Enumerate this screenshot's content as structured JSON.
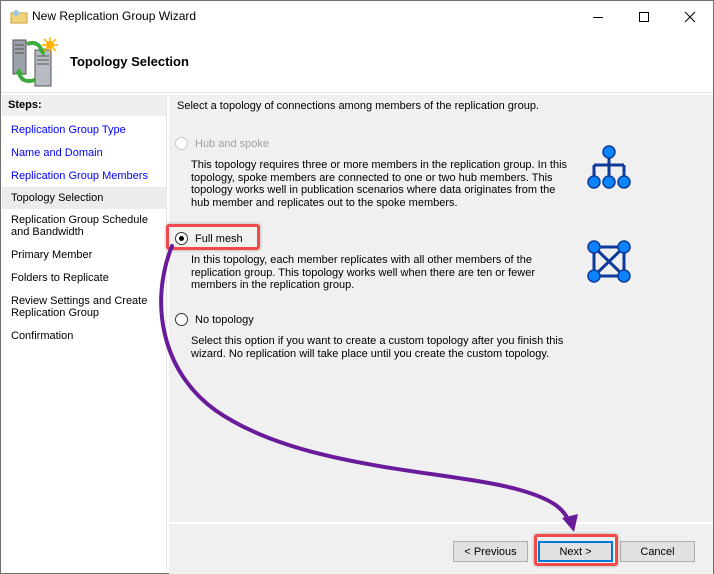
{
  "window": {
    "title": "New Replication Group Wizard",
    "controls": {
      "minimize": "minimize-icon",
      "maximize": "maximize-icon",
      "close": "close-icon"
    }
  },
  "header": {
    "page_title": "Topology Selection",
    "icon": "replication-servers-icon"
  },
  "steps": {
    "title": "Steps:",
    "items": [
      {
        "label": "Replication Group Type",
        "state": "done"
      },
      {
        "label": "Name and Domain",
        "state": "done"
      },
      {
        "label": "Replication Group Members",
        "state": "done"
      },
      {
        "label": "Topology Selection",
        "state": "current"
      },
      {
        "label": "Replication Group Schedule and Bandwidth",
        "state": "pending"
      },
      {
        "label": "Primary Member",
        "state": "pending"
      },
      {
        "label": "Folders to Replicate",
        "state": "pending"
      },
      {
        "label": "Review Settings and Create Replication Group",
        "state": "pending"
      },
      {
        "label": "Confirmation",
        "state": "pending"
      }
    ]
  },
  "main": {
    "intro": "Select a topology of connections among members of the replication group.",
    "options": [
      {
        "label": "Hub and spoke",
        "selected": false,
        "enabled": false,
        "icon": "hub-spoke-topology-icon",
        "description": "This topology requires three or more members in the replication group. In this topology, spoke members are connected to one or two hub members. This topology works well in publication scenarios where data originates from the hub member and replicates out to the spoke members."
      },
      {
        "label": "Full mesh",
        "selected": true,
        "enabled": true,
        "icon": "full-mesh-topology-icon",
        "description": "In this topology, each member replicates with all other members of the replication group. This topology works well when there are ten or fewer members in the replication group."
      },
      {
        "label": "No topology",
        "selected": false,
        "enabled": true,
        "description": "Select this option if you want to create a custom topology after you finish this wizard. No replication will take place until you create the custom topology."
      }
    ]
  },
  "footer": {
    "previous_label": "< Previous",
    "next_label": "Next >",
    "cancel_label": "Cancel"
  },
  "annotation": {
    "highlight_color": "#f04a4a",
    "arrow_color": "#6a1b9a",
    "from": "Full mesh",
    "to": "Next >"
  }
}
